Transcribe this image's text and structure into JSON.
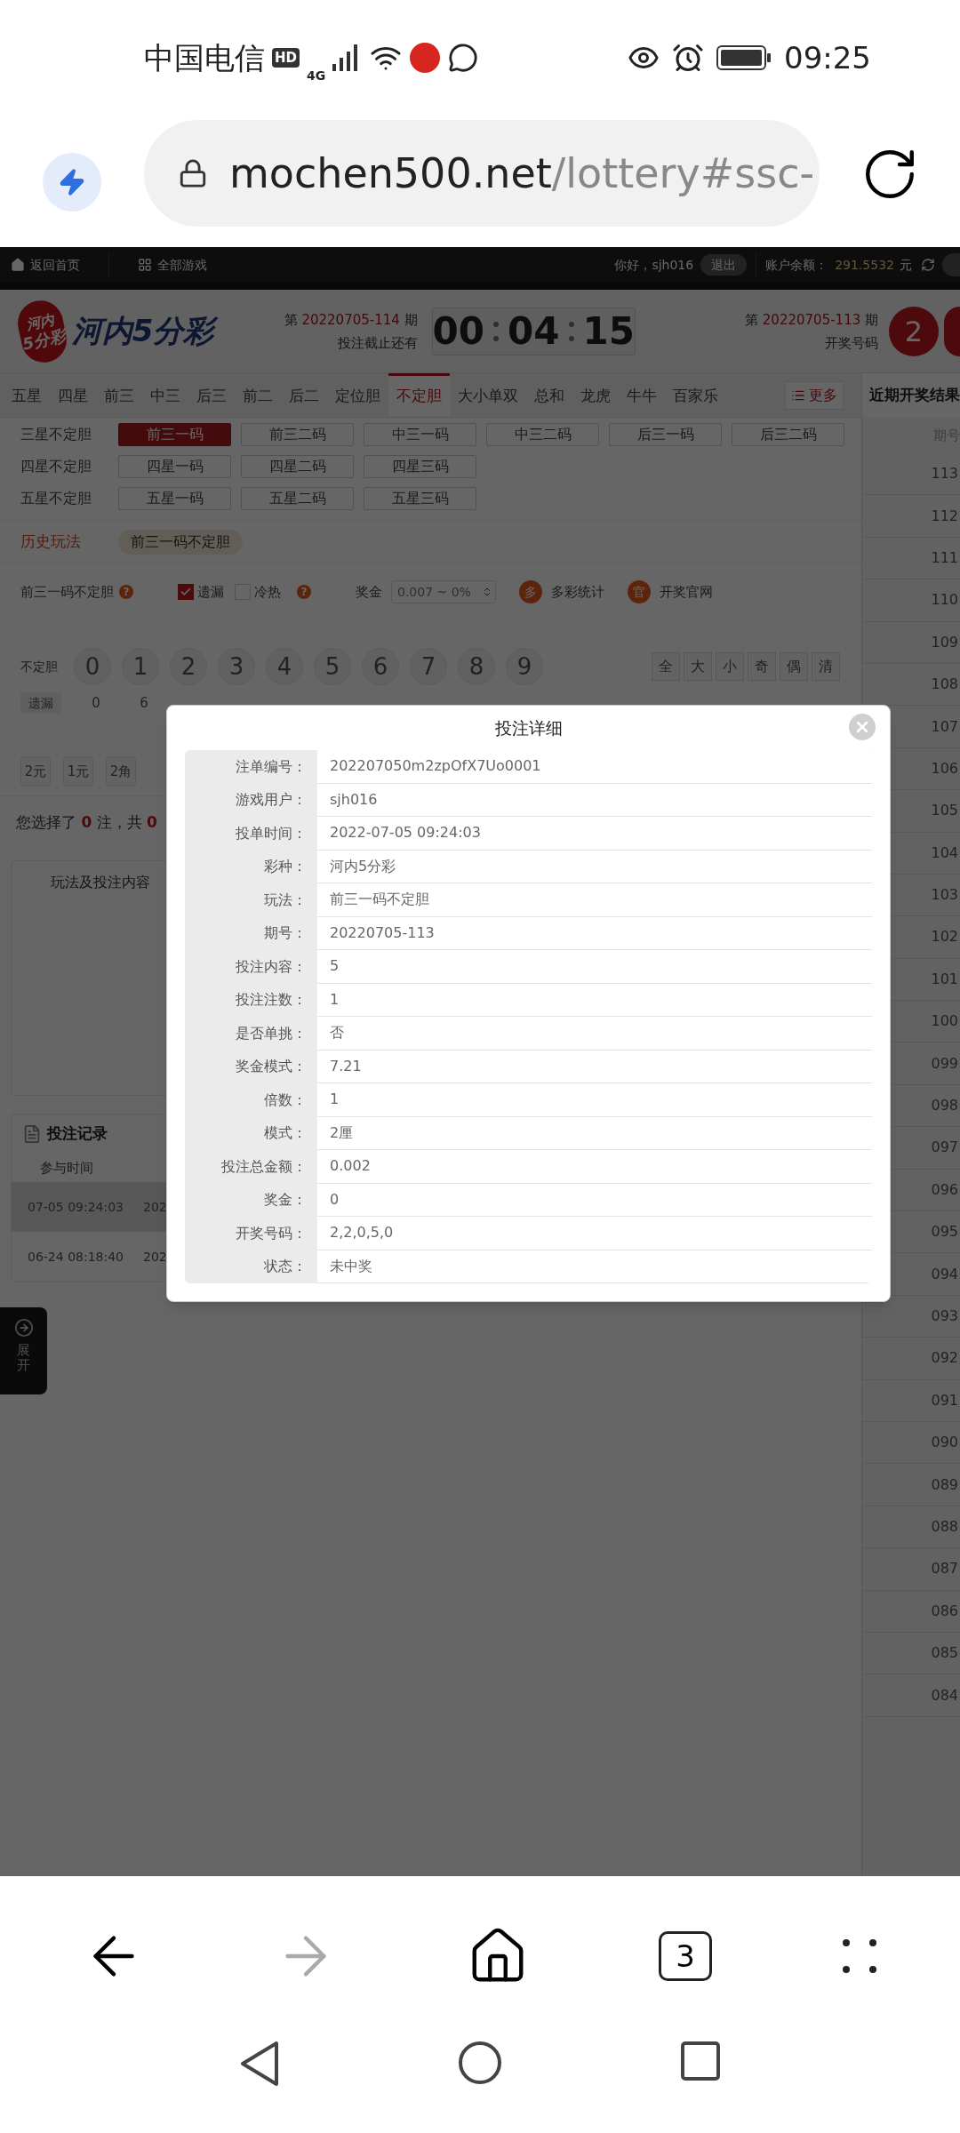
{
  "status_bar": {
    "carrier": "中国电信",
    "network_badge": "HD",
    "network_type": "4G",
    "time": "09:25"
  },
  "address_bar": {
    "domain": "mochen500.net",
    "path": "/lottery#ssc-"
  },
  "top_nav": {
    "links": [
      "返回首页",
      "全部游戏"
    ],
    "greeting": "你好，sjh016",
    "logout": "退出",
    "balance_label": "账户余额：",
    "balance": "291.5532",
    "currency": "元"
  },
  "header": {
    "logo_lines": [
      "河内",
      "5分彩"
    ],
    "title": "河内5分彩",
    "current_issue": {
      "prefix": "第",
      "issue": "20220705-114",
      "suffix": "期",
      "caption": "投注截止还有"
    },
    "countdown": [
      "00",
      "04",
      "15"
    ],
    "last_issue": {
      "prefix": "第",
      "issue": "20220705-113",
      "suffix": "期",
      "caption": "开奖号码"
    },
    "draw_balls": [
      "2"
    ]
  },
  "tabs": [
    {
      "label": "五星",
      "selected": false
    },
    {
      "label": "四星",
      "selected": false
    },
    {
      "label": "前三",
      "selected": false
    },
    {
      "label": "中三",
      "selected": false
    },
    {
      "label": "后三",
      "selected": false
    },
    {
      "label": "前二",
      "selected": false
    },
    {
      "label": "后二",
      "selected": false
    },
    {
      "label": "定位胆",
      "selected": false
    },
    {
      "label": "不定胆",
      "selected": true
    },
    {
      "label": "大小单双",
      "selected": false
    },
    {
      "label": "总和",
      "selected": false
    },
    {
      "label": "龙虎",
      "selected": false
    },
    {
      "label": "牛牛",
      "selected": false
    },
    {
      "label": "百家乐",
      "selected": false
    }
  ],
  "more_button": "更多",
  "play_groups": [
    {
      "label": "三星不定胆",
      "options": [
        {
          "label": "前三一码",
          "selected": true
        },
        {
          "label": "前三二码",
          "selected": false
        },
        {
          "label": "中三一码",
          "selected": false
        },
        {
          "label": "中三二码",
          "selected": false
        },
        {
          "label": "后三一码",
          "selected": false
        },
        {
          "label": "后三二码",
          "selected": false
        }
      ]
    },
    {
      "label": "四星不定胆",
      "options": [
        {
          "label": "四星一码",
          "selected": false
        },
        {
          "label": "四星二码",
          "selected": false
        },
        {
          "label": "四星三码",
          "selected": false
        }
      ]
    },
    {
      "label": "五星不定胆",
      "options": [
        {
          "label": "五星一码",
          "selected": false
        },
        {
          "label": "五星二码",
          "selected": false
        },
        {
          "label": "五星三码",
          "selected": false
        }
      ]
    }
  ],
  "history": {
    "label": "历史玩法",
    "chips": [
      "前三一码不定胆"
    ]
  },
  "options": {
    "play_name": "前三一码不定胆",
    "play_help": "?",
    "checkboxes": [
      {
        "label": "遗漏",
        "checked": true
      },
      {
        "label": "冷热",
        "checked": false,
        "help": "?"
      }
    ],
    "bonus_label": "奖金",
    "bonus_placeholder": "0.007 ~ 0%",
    "links": [
      {
        "badge": "多",
        "label": "多彩统计"
      },
      {
        "badge": "官",
        "label": "开奖官网"
      }
    ]
  },
  "number_picker": {
    "label": "不定胆",
    "numbers": [
      "0",
      "1",
      "2",
      "3",
      "4",
      "5",
      "6",
      "7",
      "8",
      "9"
    ],
    "quick": [
      "全",
      "大",
      "小",
      "奇",
      "偶",
      "清"
    ],
    "miss_label": "遗漏",
    "miss_values": [
      "0",
      "6"
    ]
  },
  "units": [
    "2元",
    "1元",
    "2角"
  ],
  "selection_summary": {
    "before": "您选择了",
    "count": "0",
    "middle": "注，共",
    "total": "0"
  },
  "bet_panel": {
    "header": "玩法及投注内容"
  },
  "bet_records": {
    "title": "投注记录",
    "column": "参与时间",
    "rows": [
      {
        "time": "07-05 09:24:03",
        "column_2": "202",
        "selected": true
      },
      {
        "time": "06-24 08:18:40",
        "column_2": "202",
        "selected": false
      }
    ]
  },
  "expand_tab": "展开",
  "recent_results": {
    "title": "近期开奖结果",
    "column": "期号",
    "issues": [
      "113",
      "112",
      "111",
      "110",
      "109",
      "108",
      "107",
      "106",
      "105",
      "104",
      "103",
      "102",
      "101",
      "100",
      "099",
      "098",
      "097",
      "096",
      "095",
      "094",
      "093",
      "092",
      "091",
      "090",
      "089",
      "088",
      "087",
      "086",
      "085",
      "084"
    ]
  },
  "dialog": {
    "title": "投注详细",
    "fields": [
      {
        "label": "注单编号：",
        "value": "202207050m2zpOfX7Uo0001"
      },
      {
        "label": "游戏用户：",
        "value": "sjh016"
      },
      {
        "label": "投单时间：",
        "value": "2022-07-05 09:24:03"
      },
      {
        "label": "彩种：",
        "value": "河内5分彩"
      },
      {
        "label": "玩法：",
        "value": "前三一码不定胆"
      },
      {
        "label": "期号：",
        "value": "20220705-113"
      },
      {
        "label": "投注内容：",
        "value": "5"
      },
      {
        "label": "投注注数：",
        "value": "1"
      },
      {
        "label": "是否单挑：",
        "value": "否"
      },
      {
        "label": "奖金模式：",
        "value": "7.21"
      },
      {
        "label": "倍数：",
        "value": "1"
      },
      {
        "label": "模式：",
        "value": "2厘"
      },
      {
        "label": "投注总金额：",
        "value": "0.002"
      },
      {
        "label": "奖金：",
        "value": "0"
      },
      {
        "label": "开奖号码：",
        "value": "2,2,0,5,0"
      },
      {
        "label": "状态：",
        "value": "未中奖"
      }
    ]
  },
  "browser_nav": {
    "tab_count": "3",
    "forward_disabled": true
  }
}
